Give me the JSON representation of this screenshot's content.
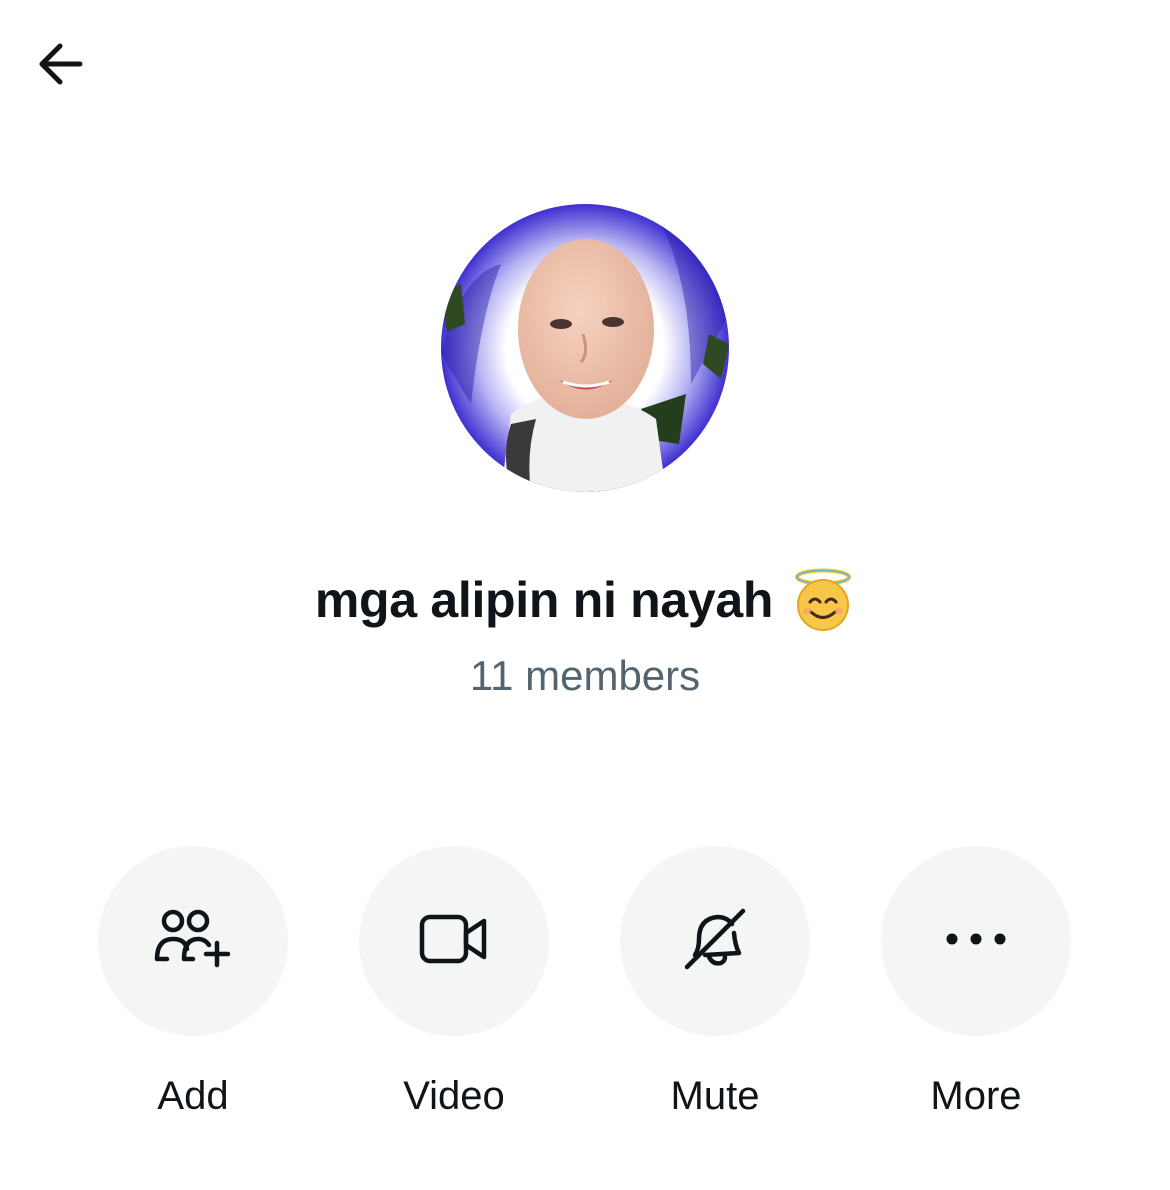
{
  "header": {
    "back_icon": "arrow-left-icon"
  },
  "group": {
    "avatar_alt": "group-avatar",
    "name": "mga alipin ni nayah",
    "name_emoji": "smiling-face-with-halo-icon",
    "members": "11 members"
  },
  "actions": [
    {
      "label": "Add",
      "icon": "add-people-icon"
    },
    {
      "label": "Video",
      "icon": "video-camera-icon"
    },
    {
      "label": "Mute",
      "icon": "bell-slash-icon"
    },
    {
      "label": "More",
      "icon": "more-dots-icon"
    }
  ],
  "colors": {
    "text": "#0f1419",
    "secondary_text": "#536471",
    "button_background": "#f4f5f5",
    "avatar_ring": "#4b3fd6"
  }
}
